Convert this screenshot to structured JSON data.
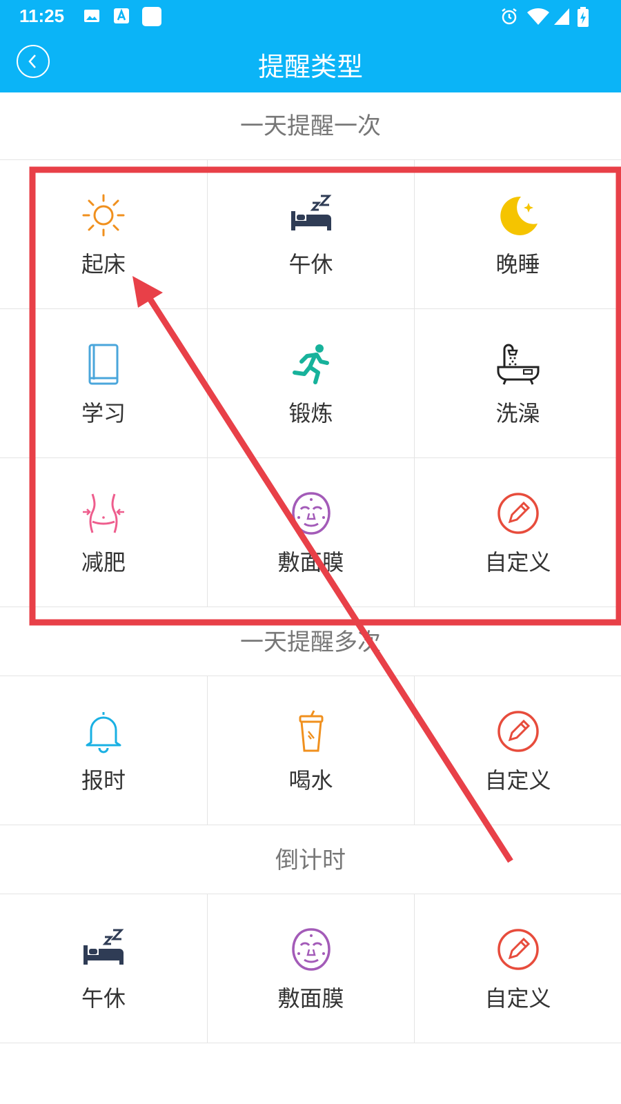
{
  "status_bar": {
    "time": "11:25"
  },
  "header": {
    "title": "提醒类型"
  },
  "sections": [
    {
      "title": "一天提醒一次",
      "rows": [
        [
          {
            "label": "起床",
            "icon": "sun-icon"
          },
          {
            "label": "午休",
            "icon": "bed-sleep-icon"
          },
          {
            "label": "晚睡",
            "icon": "moon-icon"
          }
        ],
        [
          {
            "label": "学习",
            "icon": "book-icon"
          },
          {
            "label": "锻炼",
            "icon": "running-icon"
          },
          {
            "label": "洗澡",
            "icon": "bathtub-icon"
          }
        ],
        [
          {
            "label": "减肥",
            "icon": "waist-icon"
          },
          {
            "label": "敷面膜",
            "icon": "face-mask-icon"
          },
          {
            "label": "自定义",
            "icon": "pencil-icon"
          }
        ]
      ]
    },
    {
      "title": "一天提醒多次",
      "rows": [
        [
          {
            "label": "报时",
            "icon": "bell-icon"
          },
          {
            "label": "喝水",
            "icon": "cup-icon"
          },
          {
            "label": "自定义",
            "icon": "pencil-icon"
          }
        ]
      ]
    },
    {
      "title": "倒计时",
      "rows": [
        [
          {
            "label": "午休",
            "icon": "bed-sleep-icon"
          },
          {
            "label": "敷面膜",
            "icon": "face-mask-icon"
          },
          {
            "label": "自定义",
            "icon": "pencil-icon"
          }
        ]
      ]
    }
  ],
  "colors": {
    "header": "#0bb4f7",
    "sun": "#f0901e",
    "bed": "#2f3c55",
    "moon": "#f5c400",
    "book": "#4aa6db",
    "run": "#17b29b",
    "bath": "#222222",
    "waist": "#ee5d8d",
    "mask": "#a35bb8",
    "pencil": "#e74c3c",
    "bell": "#19b0e3",
    "cup": "#f0901e",
    "annotation": "#e84048"
  }
}
